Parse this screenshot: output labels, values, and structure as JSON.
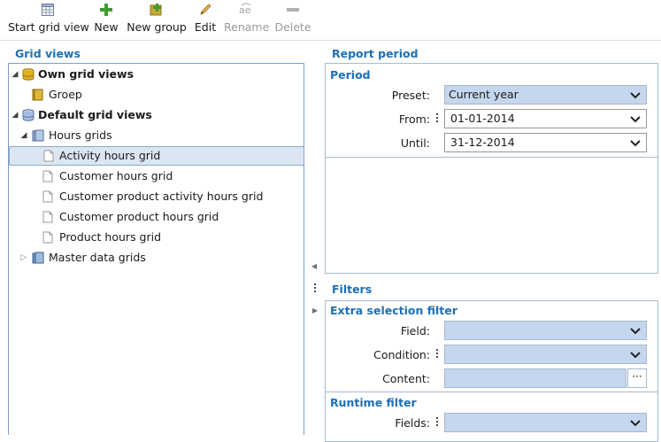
{
  "toolbar": {
    "start_grid_view": "Start grid view",
    "new": "New",
    "new_group": "New group",
    "edit": "Edit",
    "rename": "Rename",
    "delete": "Delete"
  },
  "left": {
    "title": "Grid views",
    "tree": {
      "own": "Own grid views",
      "groep": "Groep",
      "default": "Default grid views",
      "hours_grids": "Hours grids",
      "items": [
        "Activity hours grid",
        "Customer hours grid",
        "Customer product activity hours grid",
        "Customer product hours grid",
        "Product hours grid"
      ],
      "master": "Master data grids"
    }
  },
  "report": {
    "title": "Report period",
    "period": {
      "heading": "Period",
      "preset_label": "Preset:",
      "preset_value": "Current year",
      "from_label": "From:",
      "from_value": "01-01-2014",
      "until_label": "Until:",
      "until_value": "31-12-2014"
    }
  },
  "filters": {
    "title": "Filters",
    "extra": {
      "heading": "Extra selection filter",
      "field_label": "Field:",
      "condition_label": "Condition:",
      "content_label": "Content:",
      "ellipsis": "···"
    },
    "runtime": {
      "heading": "Runtime filter",
      "fields_label": "Fields:"
    }
  },
  "colors": {
    "accent": "#1e6fb5",
    "combo_fill": "#c5d7ee",
    "selection": "#dce6f2"
  }
}
